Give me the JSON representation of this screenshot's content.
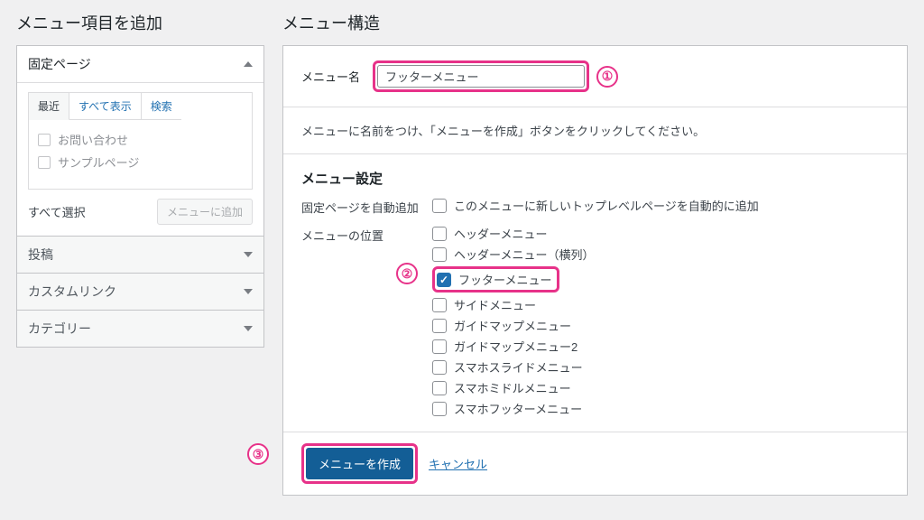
{
  "left": {
    "heading": "メニュー項目を追加",
    "boxes": {
      "pages": {
        "title": "固定ページ",
        "tabs": {
          "recent": "最近",
          "all": "すべて表示",
          "search": "検索"
        },
        "items": [
          "お問い合わせ",
          "サンプルページ"
        ],
        "select_all": "すべて選択",
        "add_button": "メニューに追加"
      },
      "posts": {
        "title": "投稿"
      },
      "custom_links": {
        "title": "カスタムリンク"
      },
      "categories": {
        "title": "カテゴリー"
      }
    }
  },
  "right": {
    "heading": "メニュー構造",
    "menu_name_label": "メニュー名",
    "menu_name_value": "フッターメニュー",
    "instruction": "メニューに名前をつけ、「メニューを作成」ボタンをクリックしてください。",
    "settings_title": "メニュー設定",
    "auto_add_label": "固定ページを自動追加",
    "auto_add_option": "このメニューに新しいトップレベルページを自動的に追加",
    "location_label": "メニューの位置",
    "locations": [
      {
        "label": "ヘッダーメニュー",
        "checked": false,
        "highlight": false
      },
      {
        "label": "ヘッダーメニュー（横列）",
        "checked": false,
        "highlight": false
      },
      {
        "label": "フッターメニュー",
        "checked": true,
        "highlight": true
      },
      {
        "label": "サイドメニュー",
        "checked": false,
        "highlight": false
      },
      {
        "label": "ガイドマップメニュー",
        "checked": false,
        "highlight": false
      },
      {
        "label": "ガイドマップメニュー2",
        "checked": false,
        "highlight": false
      },
      {
        "label": "スマホスライドメニュー",
        "checked": false,
        "highlight": false
      },
      {
        "label": "スマホミドルメニュー",
        "checked": false,
        "highlight": false
      },
      {
        "label": "スマホフッターメニュー",
        "checked": false,
        "highlight": false
      }
    ],
    "create_button": "メニューを作成",
    "cancel_link": "キャンセル"
  },
  "callouts": {
    "one": "①",
    "two": "②",
    "three": "③"
  }
}
